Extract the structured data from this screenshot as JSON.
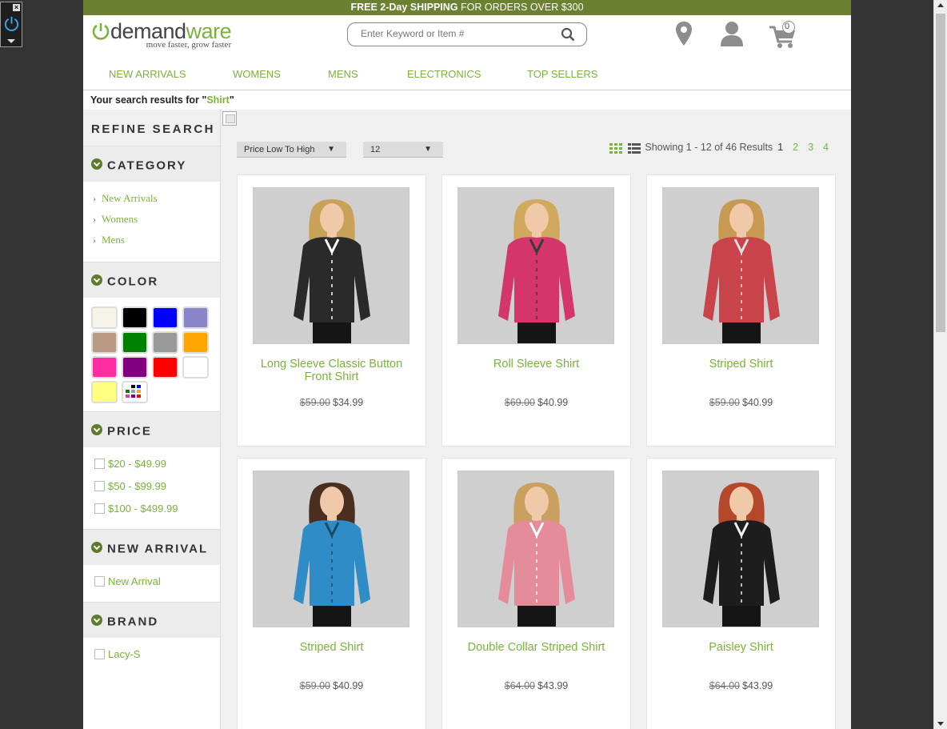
{
  "promo": {
    "highlight": "FREE 2-Day SHIPPING",
    "rest": " FOR ORDERS OVER $300"
  },
  "logo": {
    "brand_dark": "demand",
    "brand_green": "ware",
    "tagline": "move faster, grow faster"
  },
  "search": {
    "placeholder": "Enter Keyword or Item #"
  },
  "cart": {
    "count": "0"
  },
  "nav": [
    "NEW ARRIVALS",
    "WOMENS",
    "MENS",
    "ELECTRONICS",
    "TOP SELLERS"
  ],
  "results": {
    "prefix": "Your search results for \"",
    "term": "Shirt",
    "suffix": "\""
  },
  "sidebar": {
    "refine_title": "REFINE SEARCH",
    "category": {
      "title": "CATEGORY",
      "items": [
        "New Arrivals",
        "Womens",
        "Mens"
      ]
    },
    "color": {
      "title": "COLOR",
      "swatches": [
        "#f6f3e8",
        "#000000",
        "#0000ff",
        "#8a84c9",
        "#b99a82",
        "#008000",
        "#9a9a9a",
        "#ffa500",
        "#ff2d9f",
        "#800080",
        "#ff0000",
        "#ffffff",
        "#ffff80",
        "multi"
      ]
    },
    "price": {
      "title": "PRICE",
      "items": [
        "$20 - $49.99",
        "$50 - $99.99",
        "$100 - $499.99"
      ]
    },
    "new_arrival": {
      "title": "NEW ARRIVAL",
      "items": [
        "New Arrival"
      ]
    },
    "brand": {
      "title": "BRAND",
      "items": [
        "Lacy-S"
      ]
    }
  },
  "toolbar": {
    "sort": "Price Low To High",
    "per_page": "12",
    "showing": "Showing 1 - 12 of 46 Results",
    "pages": [
      "1",
      "2",
      "3",
      "4"
    ]
  },
  "products": [
    {
      "name": "Long Sleeve Classic Button Front Shirt",
      "old_price": "$59.00",
      "price": "$34.99",
      "shirt": "#2a2a2a",
      "accent": "#ffffff",
      "hair": "#c9a25a"
    },
    {
      "name": "Roll Sleeve Shirt",
      "old_price": "$69.00",
      "price": "$40.99",
      "shirt": "#d4356b",
      "accent": "#3a3a3a",
      "hair": "#d0a85e"
    },
    {
      "name": "Striped Shirt",
      "old_price": "$59.00",
      "price": "$40.99",
      "shirt": "#c9444a",
      "accent": "#e0e0e0",
      "hair": "#c69a52"
    },
    {
      "name": "Striped Shirt",
      "old_price": "$59.00",
      "price": "$40.99",
      "shirt": "#2f8cc6",
      "accent": "#1a4a6a",
      "hair": "#4a2e20"
    },
    {
      "name": "Double Collar Striped Shirt",
      "old_price": "$64.00",
      "price": "$43.99",
      "shirt": "#e48c9a",
      "accent": "#ffffff",
      "hair": "#c9a060"
    },
    {
      "name": "Paisley Shirt",
      "old_price": "$64.00",
      "price": "$43.99",
      "shirt": "#1d1d1d",
      "accent": "#f2f2f2",
      "hair": "#b3482a"
    }
  ]
}
